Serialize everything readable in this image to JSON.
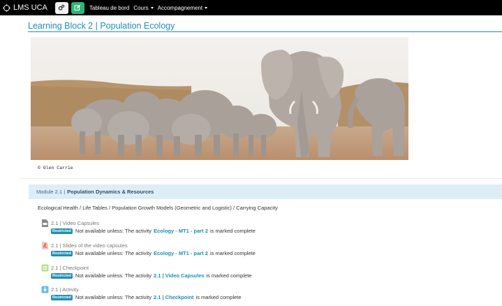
{
  "navbar": {
    "brand": "LMS UCA",
    "links": [
      {
        "label": "Tableau de bord",
        "dropdown": false
      },
      {
        "label": "Cours",
        "dropdown": true
      },
      {
        "label": "Accompagnement",
        "dropdown": true
      }
    ]
  },
  "page": {
    "title_prefix": "Learning Block 2 |",
    "title_main": "Population Ecology",
    "image_caption": "© Glen Carrie"
  },
  "module": {
    "prefix": "Module 2.1 |",
    "title": "Population Dynamics & Resources",
    "summary": "Ecological Health / Life Tables / Population Growth Models (Geometric and Logistic) / Carrying Capacity"
  },
  "activities": [
    {
      "icon": "video-file-icon",
      "name": "2.1 | Video Capsules",
      "badge": "Restricted",
      "cond_before": "Not available unless: The activity",
      "cond_link": "Ecology - MT1 - part 2",
      "cond_after": "is marked complete"
    },
    {
      "icon": "pdf-file-icon",
      "name": "2.1 | Slides of the video capsules",
      "badge": "Restricted",
      "cond_before": "Not available unless: The activity",
      "cond_link": "Ecology - MT1 - part 2",
      "cond_after": "is marked complete"
    },
    {
      "icon": "checkpoint-icon",
      "name": "2.1 | Checkpoint",
      "badge": "Restricted",
      "cond_before": "Not available unless: The activity",
      "cond_link": "2.1 | Video Capsules",
      "cond_after": "is marked complete"
    },
    {
      "icon": "activity-icon",
      "name": "2.1 | Activity",
      "badge": "Restricted",
      "cond_before": "Not available unless: The activity",
      "cond_link": "2.1 | Checkpoint",
      "cond_after": "is marked complete"
    }
  ],
  "colors": {
    "navbar_bg": "#000000",
    "accent": "#1f8fb3",
    "module_bg": "#ddeef6",
    "edit_button": "#2bb673"
  }
}
